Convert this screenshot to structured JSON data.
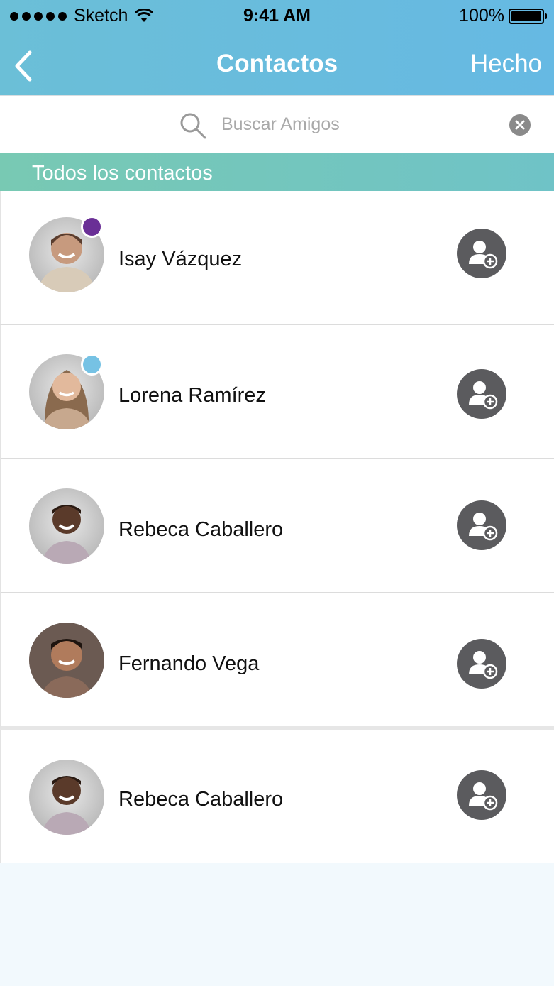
{
  "status_bar": {
    "carrier": "Sketch",
    "time": "9:41 AM",
    "battery": "100%"
  },
  "nav": {
    "title": "Contactos",
    "done_label": "Hecho",
    "back_icon": "chevron-left-icon"
  },
  "search": {
    "placeholder": "Buscar Amigos",
    "value": ""
  },
  "section": {
    "title": "Todos los contactos"
  },
  "contacts": [
    {
      "name": "Isay Vázquez",
      "presence": "#6a2f96"
    },
    {
      "name": "Lorena Ramírez",
      "presence": "#76c2e4"
    },
    {
      "name": "Rebeca Caballero",
      "presence": ""
    },
    {
      "name": "Fernando Vega",
      "presence": ""
    },
    {
      "name": "Rebeca Caballero",
      "presence": ""
    }
  ],
  "colors": {
    "header": "#66b9e3",
    "section": "#74c6bc",
    "add_button": "#5b5b5e"
  }
}
